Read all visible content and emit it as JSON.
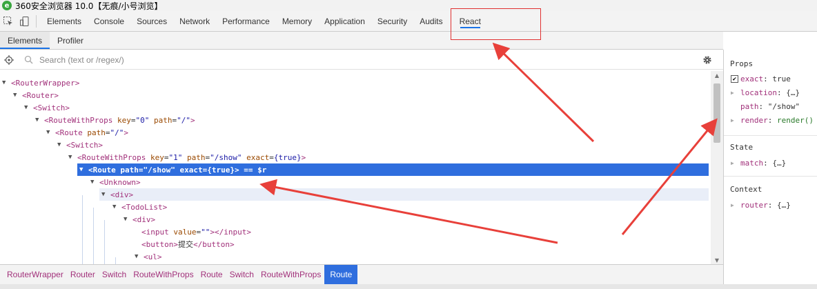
{
  "window": {
    "title": "360安全浏览器 10.0【无痕/小号浏览】",
    "logo_letter": "e"
  },
  "toolbar": {
    "tabs": [
      "Elements",
      "Console",
      "Sources",
      "Network",
      "Performance",
      "Memory",
      "Application",
      "Security",
      "Audits",
      "React"
    ],
    "active_tab": "React"
  },
  "subtabs": {
    "items": [
      "Elements",
      "Profiler"
    ],
    "active": "Elements"
  },
  "search": {
    "placeholder": "Search (text or /regex/)"
  },
  "tree": {
    "rows": [
      {
        "depth": 0,
        "arrow": "▼",
        "parts": [
          [
            "tag",
            "<RouterWrapper>"
          ]
        ]
      },
      {
        "depth": 1,
        "arrow": "▼",
        "parts": [
          [
            "tag",
            "<Router>"
          ]
        ]
      },
      {
        "depth": 2,
        "arrow": "▼",
        "parts": [
          [
            "tag",
            "<Switch>"
          ]
        ]
      },
      {
        "depth": 3,
        "arrow": "▼",
        "parts": [
          [
            "tag",
            "<RouteWithProps"
          ],
          [
            "plain",
            " "
          ],
          [
            "attr",
            "key"
          ],
          [
            "plain",
            "="
          ],
          [
            "val",
            "\"0\""
          ],
          [
            "plain",
            " "
          ],
          [
            "attr",
            "path"
          ],
          [
            "plain",
            "="
          ],
          [
            "val",
            "\"/\""
          ],
          [
            "tag",
            ">"
          ]
        ]
      },
      {
        "depth": 4,
        "arrow": "▼",
        "parts": [
          [
            "tag",
            "<Route"
          ],
          [
            "plain",
            " "
          ],
          [
            "attr",
            "path"
          ],
          [
            "plain",
            "="
          ],
          [
            "val",
            "\"/\""
          ],
          [
            "tag",
            ">"
          ]
        ]
      },
      {
        "depth": 5,
        "arrow": "▼",
        "parts": [
          [
            "tag",
            "<Switch>"
          ]
        ]
      },
      {
        "depth": 6,
        "arrow": "▼",
        "parts": [
          [
            "tag",
            "<RouteWithProps"
          ],
          [
            "plain",
            " "
          ],
          [
            "attr",
            "key"
          ],
          [
            "plain",
            "="
          ],
          [
            "val",
            "\"1\""
          ],
          [
            "plain",
            " "
          ],
          [
            "attr",
            "path"
          ],
          [
            "plain",
            "="
          ],
          [
            "val",
            "\"/show\""
          ],
          [
            "plain",
            " "
          ],
          [
            "attr",
            "exact"
          ],
          [
            "plain",
            "="
          ],
          [
            "val",
            "{true}"
          ],
          [
            "tag",
            ">"
          ]
        ]
      },
      {
        "depth": 7,
        "arrow": "▼",
        "selected": true,
        "parts": [
          [
            "tag",
            "<Route"
          ],
          [
            "plain",
            " "
          ],
          [
            "attr",
            "path"
          ],
          [
            "plain",
            "="
          ],
          [
            "val",
            "\"/show\""
          ],
          [
            "plain",
            " "
          ],
          [
            "attr",
            "exact"
          ],
          [
            "plain",
            "="
          ],
          [
            "val",
            "{true}"
          ],
          [
            "tag",
            ">"
          ],
          [
            "plain",
            " == $r"
          ]
        ]
      },
      {
        "depth": 8,
        "arrow": "▼",
        "parts": [
          [
            "tag",
            "<Unknown>"
          ]
        ]
      },
      {
        "depth": 9,
        "arrow": "▼",
        "hover": true,
        "parts": [
          [
            "tag",
            "<div>"
          ]
        ]
      },
      {
        "depth": 10,
        "arrow": "▼",
        "parts": [
          [
            "tag",
            "<TodoList>"
          ]
        ]
      },
      {
        "depth": 11,
        "arrow": "▼",
        "parts": [
          [
            "tag",
            "<div>"
          ]
        ]
      },
      {
        "depth": 12,
        "arrow": "",
        "parts": [
          [
            "tag",
            "<input"
          ],
          [
            "plain",
            " "
          ],
          [
            "attr",
            "value"
          ],
          [
            "plain",
            "="
          ],
          [
            "val",
            "\"\""
          ],
          [
            "tag",
            "></input>"
          ]
        ]
      },
      {
        "depth": 12,
        "arrow": "",
        "parts": [
          [
            "tag",
            "<button>"
          ],
          [
            "plain",
            "提交"
          ],
          [
            "tag",
            "</button>"
          ]
        ]
      },
      {
        "depth": 12,
        "arrow": "▼",
        "parts": [
          [
            "tag",
            "<ul>"
          ]
        ]
      }
    ]
  },
  "breadcrumb": {
    "items": [
      "RouterWrapper",
      "Router",
      "Switch",
      "RouteWithProps",
      "Route",
      "Switch",
      "RouteWithProps",
      "Route"
    ],
    "active_index": 7
  },
  "panel": {
    "props_title": "Props",
    "props": [
      {
        "expandable": false,
        "checkbox": true,
        "name": "exact",
        "value": "true",
        "kind": "plain"
      },
      {
        "expandable": true,
        "checkbox": false,
        "name": "location",
        "value": "{…}",
        "kind": "plain"
      },
      {
        "expandable": false,
        "checkbox": false,
        "name": "path",
        "value": "\"/show\"",
        "kind": "plain"
      },
      {
        "expandable": true,
        "checkbox": false,
        "name": "render",
        "value": "render()",
        "kind": "fn"
      }
    ],
    "state_title": "State",
    "state": [
      {
        "expandable": true,
        "name": "match",
        "value": "{…}"
      }
    ],
    "context_title": "Context",
    "context": [
      {
        "expandable": true,
        "name": "router",
        "value": "{…}"
      }
    ]
  },
  "icons": {
    "inspect": "inspect-element-icon",
    "device": "device-toolbar-icon",
    "target": "select-target-icon",
    "search": "search-icon",
    "settings": "gear-icon"
  },
  "colors": {
    "accent": "#1a73e8",
    "selected_row": "#2f6ede",
    "tag": "#a1307a",
    "attr": "#9a4900",
    "value": "#1a1aa6",
    "annotation": "#e03030"
  }
}
